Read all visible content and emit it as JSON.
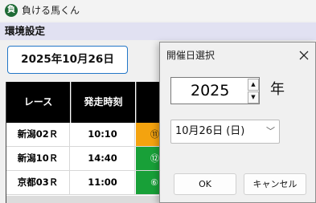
{
  "app": {
    "icon_glyph": "負",
    "title": "負ける馬くん"
  },
  "menu": {
    "settings_label": "環境設定"
  },
  "date_button": {
    "label": "2025年10月26日"
  },
  "race_table": {
    "headers": [
      "レース",
      "発走時刻",
      ""
    ],
    "rows": [
      {
        "race": "新潟02Ｒ",
        "time": "10:10",
        "badge": "⑪",
        "badge_color": "#f4a30f"
      },
      {
        "race": "新潟10Ｒ",
        "time": "14:40",
        "badge": "⑫",
        "badge_color": "#18a038"
      },
      {
        "race": "京都03Ｒ",
        "time": "11:00",
        "badge": "⑥",
        "badge_color": "#18a038"
      }
    ]
  },
  "dialog": {
    "title": "開催日選択",
    "close_icon": "close-icon",
    "year_value": "2025",
    "spin_up_glyph": "▲",
    "spin_down_glyph": "▼",
    "year_unit": "年",
    "date_select_value": "10月26日 (日)",
    "chevron_glyph": "﹀",
    "ok_label": "OK",
    "cancel_label": "キャンセル"
  },
  "colors": {
    "accent_border": "#2276c7",
    "menubar_bg": "#e1e1f2",
    "table_header_bg": "#000000"
  }
}
